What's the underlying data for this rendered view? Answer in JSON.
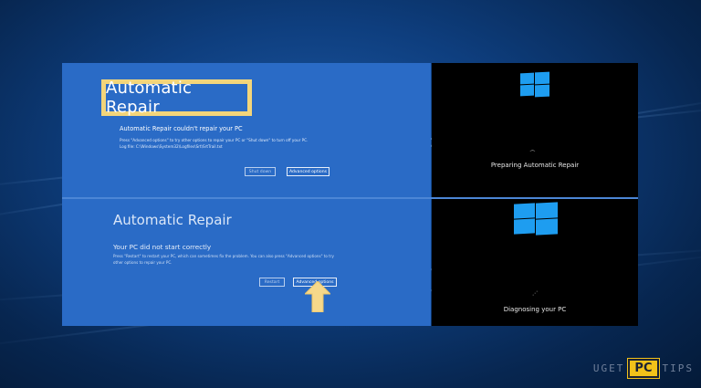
{
  "top_left": {
    "title": "Automatic Repair",
    "subtitle": "Automatic Repair couldn't repair your PC",
    "line1": "Press \"Advanced options\" to try other options to repair your PC or \"Shut down\" to turn off your PC.",
    "line2": "Log file: C:\\Windows\\System32\\Logfiles\\Srt\\SrtTrail.txt",
    "shutdown_label": "Shut down",
    "advanced_label": "Advanced options"
  },
  "bottom_left": {
    "title": "Automatic Repair",
    "subtitle": "Your PC did not start correctly",
    "line1": "Press \"Restart\" to restart your PC, which can sometimes fix the problem. You can also press \"Advanced options\" to try",
    "line2": "other options to repair your PC.",
    "restart_label": "Restart",
    "advanced_label": "Advanced options"
  },
  "top_right": {
    "status": "Preparing Automatic Repair"
  },
  "bottom_right": {
    "status": "Diagnosing your PC"
  },
  "watermark": {
    "left": "UGET",
    "middle": "PC",
    "right": "TIPS"
  },
  "colors": {
    "recovery_blue": "#2a6bc6",
    "highlight": "#f3d57a",
    "windows_logo": "#1e9df0",
    "pointer": "#f6d88a"
  },
  "icons": {
    "logo": "windows-logo-icon",
    "spinner": "loading-spinner-icon",
    "pointer": "arrow-pointer-icon"
  }
}
